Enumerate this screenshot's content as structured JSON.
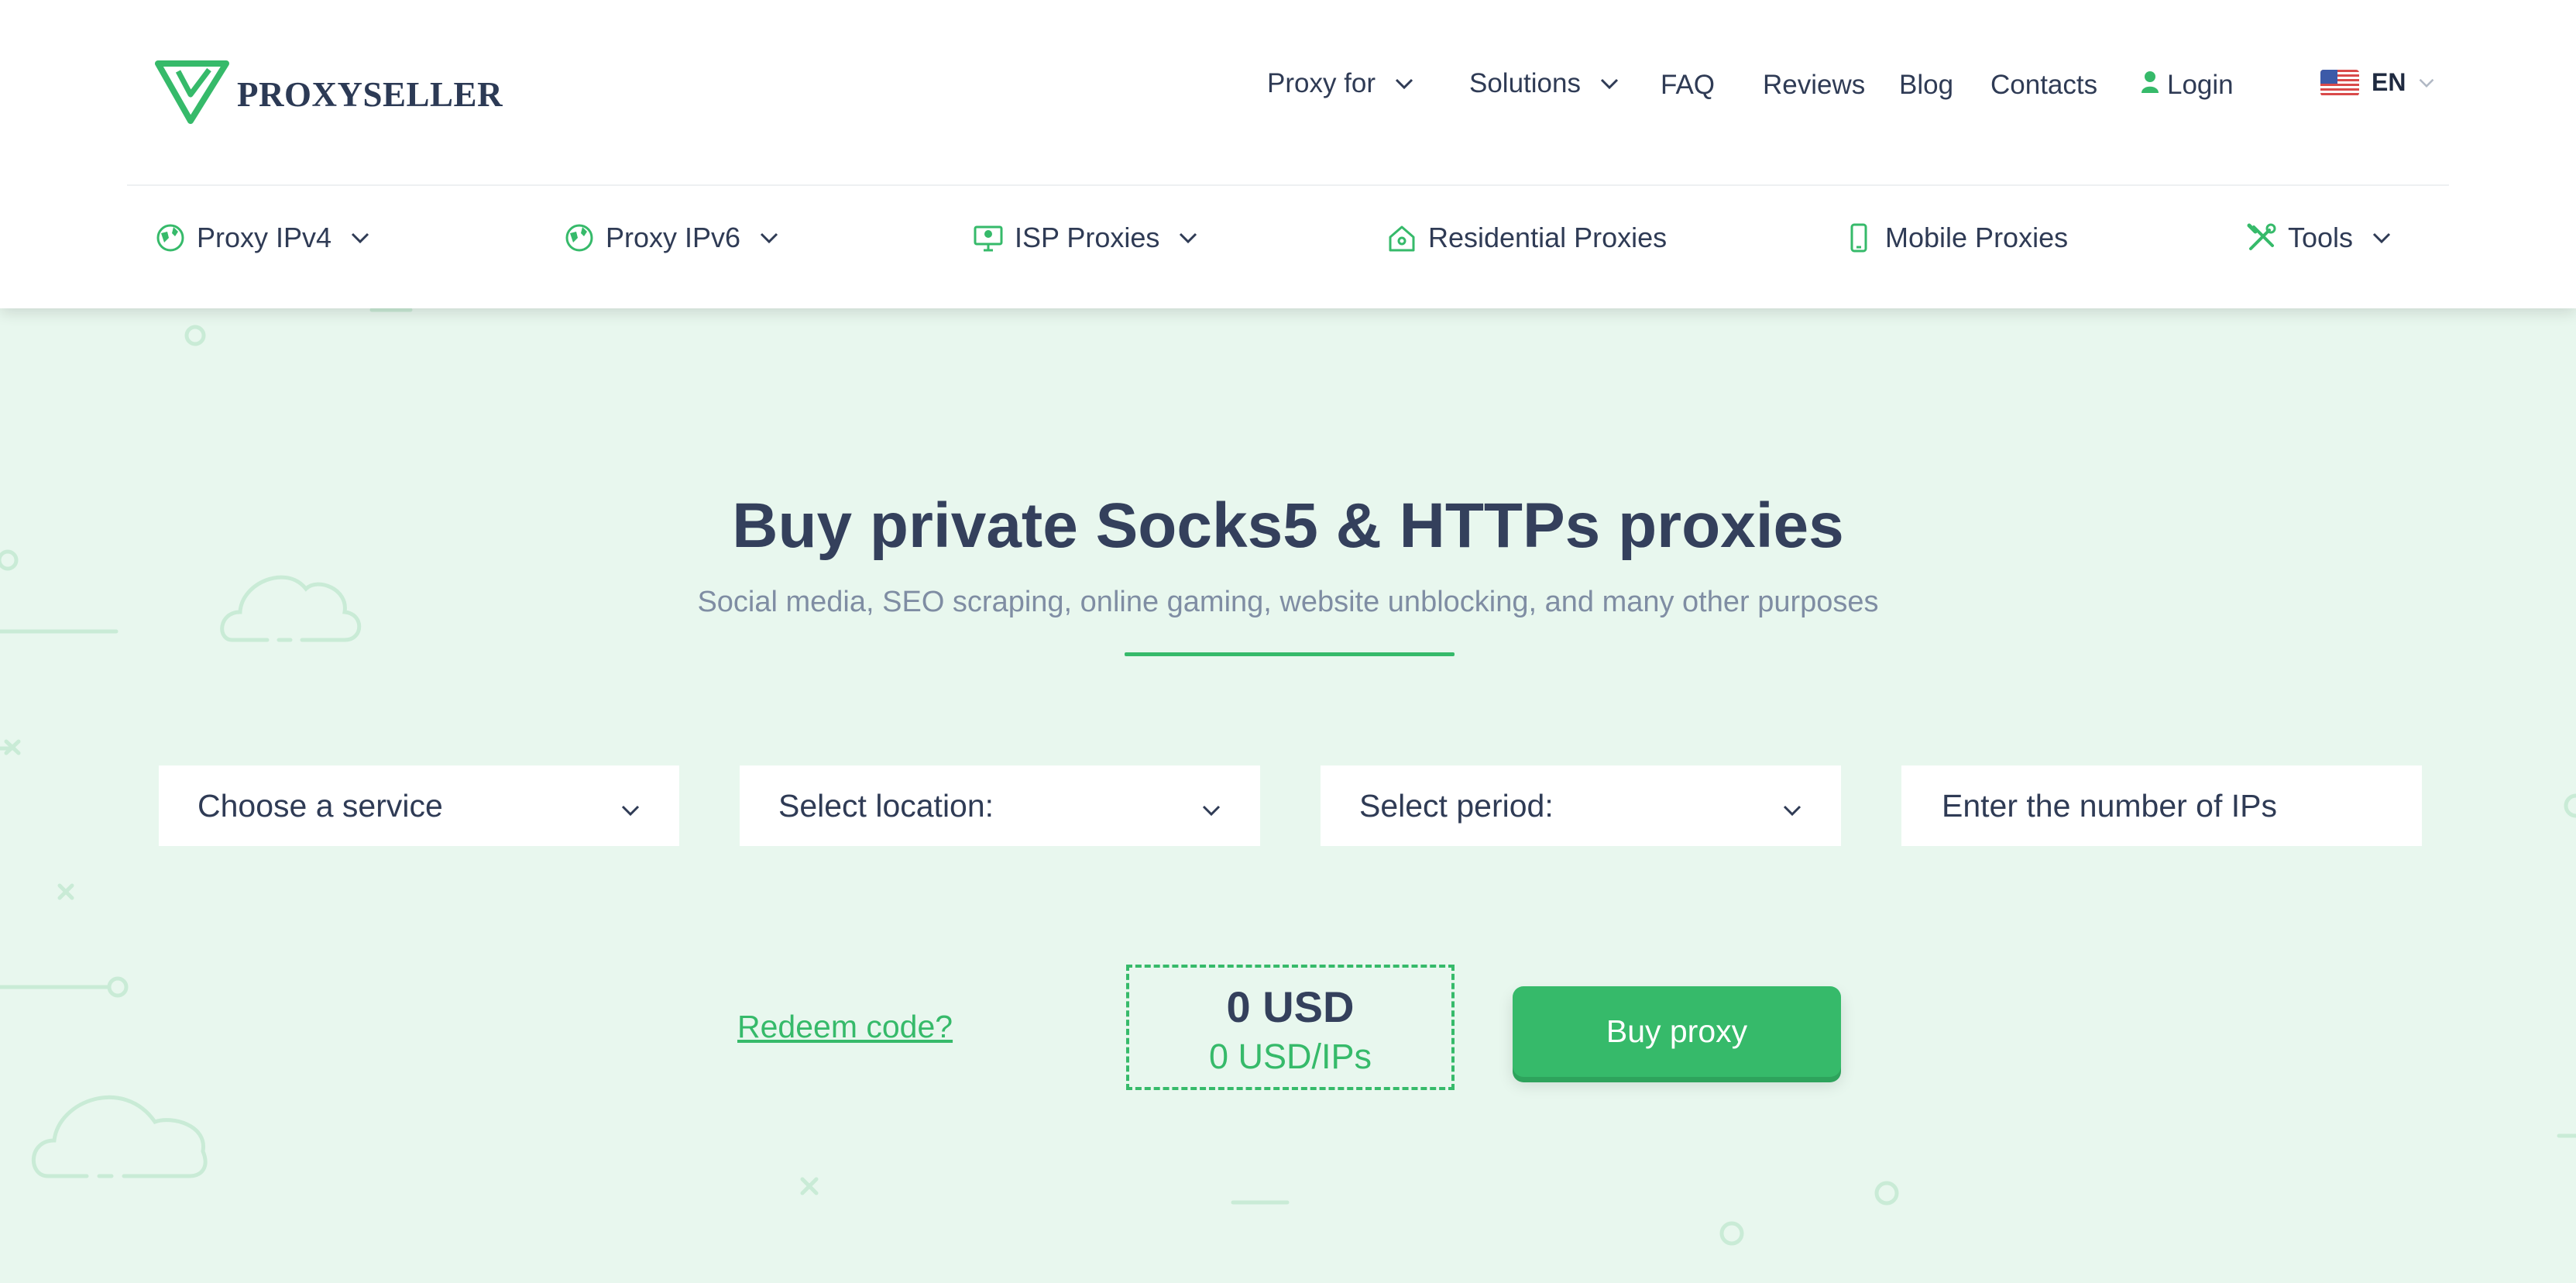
{
  "brand": {
    "name": "PROXYSELLER"
  },
  "top_nav": {
    "proxy_for": "Proxy for",
    "solutions": "Solutions",
    "faq": "FAQ",
    "reviews": "Reviews",
    "blog": "Blog",
    "contacts": "Contacts",
    "login": "Login",
    "language": "EN"
  },
  "sub_nav": {
    "ipv4": "Proxy IPv4",
    "ipv6": "Proxy IPv6",
    "isp": "ISP Proxies",
    "residential": "Residential Proxies",
    "mobile": "Mobile Proxies",
    "tools": "Tools"
  },
  "hero": {
    "title": "Buy private Socks5 & HTTPs proxies",
    "subtitle": "Social media, SEO scraping, online gaming, website unblocking, and many other purposes"
  },
  "form": {
    "service_placeholder": "Choose a service",
    "location_placeholder": "Select location:",
    "period_placeholder": "Select period:",
    "ips_placeholder": "Enter the number of IPs"
  },
  "purchase": {
    "redeem_label": "Redeem code?",
    "total": "0 USD",
    "per_ip": "0 USD/IPs",
    "buy_label": "Buy proxy"
  },
  "colors": {
    "accent": "#36ba6a",
    "text_dark": "#34405c",
    "background": "#e8f7ee"
  },
  "icons": [
    "logo-icon",
    "chevron-down-icon",
    "user-icon",
    "flag-us-icon",
    "globe-icon",
    "monitor-icon",
    "home-icon",
    "phone-icon",
    "tools-icon"
  ]
}
